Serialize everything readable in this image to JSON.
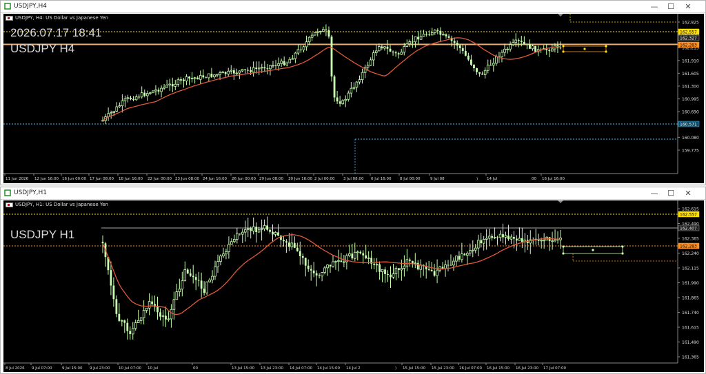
{
  "top_window": {
    "title": "USDJPY,H4",
    "info": "USDJPY, H4:  US Dollar vs Japanese Yen",
    "datetime_overlay": "2026.07.17 18:41",
    "symbol_label": "USDJPY H4",
    "price_ticks": [
      "162.825",
      "162.520",
      "162.215",
      "161.910",
      "161.605",
      "161.300",
      "160.995",
      "160.690",
      "160.385",
      "160.080",
      "159.775"
    ],
    "price_tags": [
      {
        "value": "162.557",
        "type": "ask",
        "color": "#ffe000"
      },
      {
        "value": "162.327",
        "type": "line",
        "color": "#a0a0a0"
      },
      {
        "value": "162.283",
        "type": "bid",
        "color": "#ff9020"
      },
      {
        "value": "160.571",
        "type": "dotted",
        "color": "#40c0ff"
      }
    ],
    "time_ticks": [
      "11 Jun 2026",
      "12 Jun 16:00",
      "16 Jun 00:00",
      "17 Jun 08:00",
      "18 Jun 16:00",
      "22 Jun 00:00",
      "23 Jun 08:00",
      "24 Jun 16:00",
      "26 Jun 00:00",
      "29 Jun 08:00",
      "30 Jun 16:00",
      "2 Jul 00:00",
      "3 Jul 08:00",
      "6 Jul 16:00",
      "8 Jul 00:00",
      "9 Jul 08",
      "14 Jul",
      "16 Jul 16:00"
    ],
    "extra_tick": ")",
    "extra_tick_00": "00"
  },
  "bottom_window": {
    "title": "USDJPY,H1",
    "info": "USDJPY, H1:  US Dollar vs Japanese Yen",
    "symbol_label": "USDJPY H1",
    "price_ticks": [
      "162.615",
      "162.490",
      "162.365",
      "162.240",
      "162.115",
      "161.990",
      "161.865",
      "161.740",
      "161.615",
      "161.490",
      "161.365"
    ],
    "price_tags": [
      {
        "value": "162.557",
        "type": "ask",
        "color": "#ffe000"
      },
      {
        "value": "162.407",
        "type": "line",
        "color": "#a0a0a0"
      },
      {
        "value": "162.283",
        "type": "bid",
        "color": "#ff9020"
      }
    ],
    "time_ticks": [
      "8 Jul 2026",
      "9 Jul 07:00",
      "9 Jul 15:00",
      "9 Jul 23:00",
      "10 Jul 07:00",
      "10 Jul",
      "00",
      "13 Jul 15:00",
      "13 Jul 23:00",
      "14 Jul 07:00",
      "14 Jul 15:00",
      "14 Jul 2",
      "15 Jul 15:00",
      "15 Jul 23:00",
      "16 Jul 07:00",
      "16 Jul 15:00",
      "16 Jul 23:00",
      "17 Jul 07:00"
    ],
    "extra_tick": ")"
  },
  "window_buttons": {
    "minimize": "—",
    "maximize": "☐",
    "close": "✕"
  },
  "colors": {
    "bull": "#c8ffb0",
    "bear": "#c8ffb0",
    "ma": "#e05a3a",
    "grid": "#7a7a7a",
    "ask": "#ffe000",
    "bid": "#ff9020",
    "cyan": "#40c0ff"
  }
}
